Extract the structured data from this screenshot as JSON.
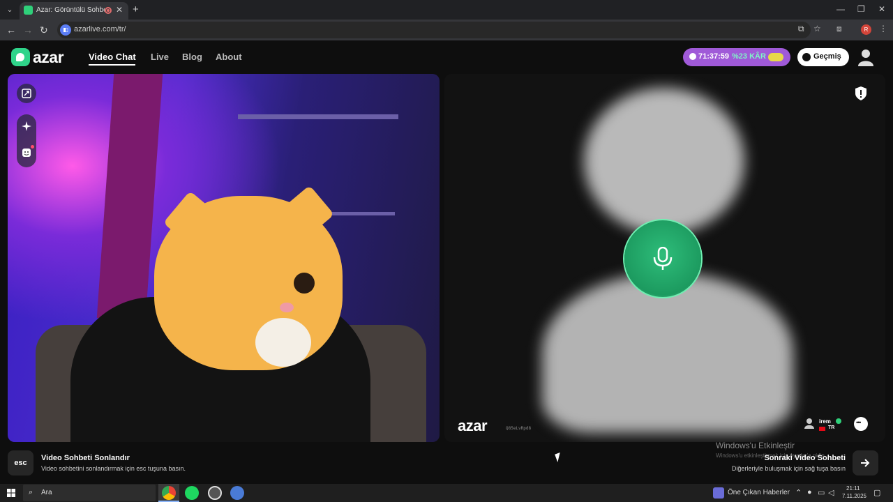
{
  "browser": {
    "tab_title": "Azar: Görüntülü Sohbet, Yeni",
    "tab_close": "✕",
    "new_tab": "+",
    "url": "azarlive.com/tr/",
    "profile_initial": "R",
    "window_controls": [
      "—",
      "❐",
      "✕"
    ]
  },
  "header": {
    "logo_text": "azar",
    "nav": [
      {
        "label": "Video Chat",
        "active": true
      },
      {
        "label": "Live"
      },
      {
        "label": "Blog"
      },
      {
        "label": "About"
      }
    ],
    "timer": "71:37:59",
    "promo": "%23 KÂR",
    "history_label": "Geçmiş"
  },
  "partner": {
    "watermark": "azar",
    "id_text": "Q85eLvRpd8",
    "name": "irem",
    "country": "TR"
  },
  "bottom": {
    "esc_label": "esc",
    "end_title": "Video Sohbeti Sonlandır",
    "end_sub": "Video sohbetini sonlandırmak için esc tuşuna basın.",
    "next_title": "Sonraki Video Sohbeti",
    "next_sub": "Diğerleriyle buluşmak için sağ tuşa basın",
    "activate_title": "Windows'u Etkinleştir",
    "activate_sub": "Windows'u etkinleştirmek için Ayarlar'a gidin."
  },
  "taskbar": {
    "search_placeholder": "Ara",
    "news_label": "Öne Çıkan Haberler",
    "time": "21:11",
    "date": "7.11.2025"
  },
  "colors": {
    "brand_green": "#2fd48a",
    "timer_purple": "#a05ad8",
    "mic_green": "#1c9a5f"
  }
}
